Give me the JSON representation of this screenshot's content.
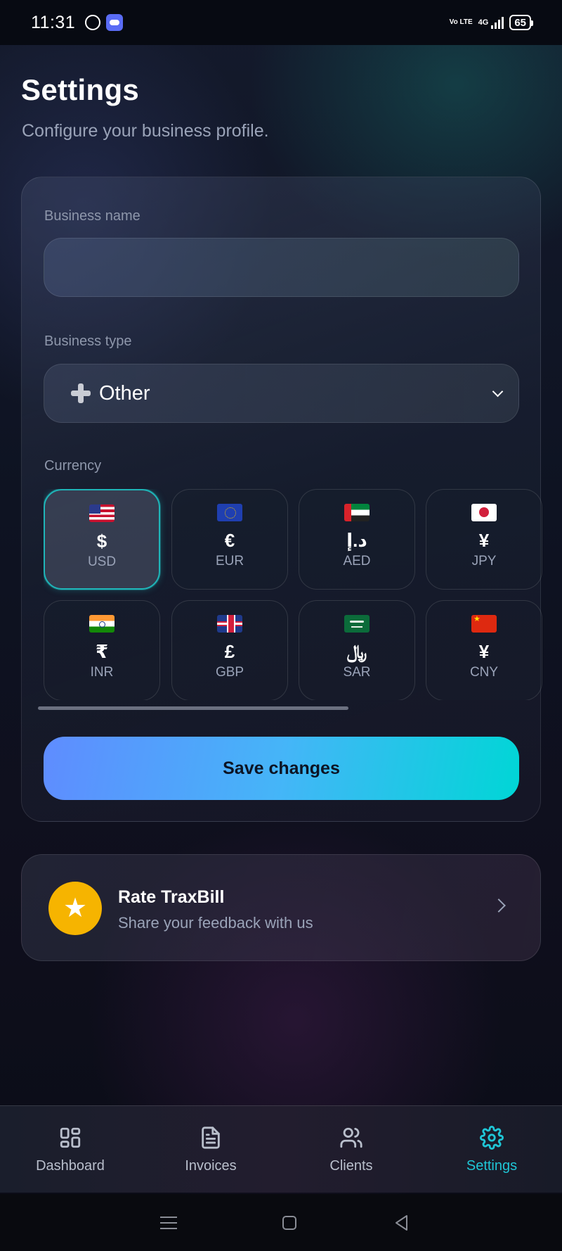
{
  "status_bar": {
    "time": "11:31",
    "network": "4G",
    "volte": "Vo LTE",
    "battery": "65"
  },
  "header": {
    "title": "Settings",
    "subtitle": "Configure your business profile."
  },
  "form": {
    "business_name_label": "Business name",
    "business_name_value": "",
    "business_type_label": "Business type",
    "business_type_icon": "plus-icon",
    "business_type_value": "Other",
    "currency_label": "Currency",
    "currencies": [
      {
        "code": "USD",
        "symbol": "$",
        "flag": "us-flag-icon",
        "selected": true
      },
      {
        "code": "EUR",
        "symbol": "€",
        "flag": "eu-flag-icon",
        "selected": false
      },
      {
        "code": "AED",
        "symbol": "د.إ",
        "flag": "ae-flag-icon",
        "selected": false
      },
      {
        "code": "JPY",
        "symbol": "¥",
        "flag": "jp-flag-icon",
        "selected": false
      },
      {
        "code": "INR",
        "symbol": "₹",
        "flag": "in-flag-icon",
        "selected": false
      },
      {
        "code": "GBP",
        "symbol": "£",
        "flag": "gb-flag-icon",
        "selected": false
      },
      {
        "code": "SAR",
        "symbol": "﷼",
        "flag": "sa-flag-icon",
        "selected": false
      },
      {
        "code": "CNY",
        "symbol": "¥",
        "flag": "cn-flag-icon",
        "selected": false
      }
    ],
    "save_label": "Save changes"
  },
  "rate": {
    "title": "Rate TraxBill",
    "subtitle": "Share your feedback with us",
    "icon": "star-icon"
  },
  "nav": {
    "items": [
      {
        "label": "Dashboard",
        "icon": "grid-icon",
        "active": false
      },
      {
        "label": "Invoices",
        "icon": "document-icon",
        "active": false
      },
      {
        "label": "Clients",
        "icon": "users-icon",
        "active": false
      },
      {
        "label": "Settings",
        "icon": "gear-icon",
        "active": true
      }
    ]
  },
  "colors": {
    "accent": "#1fc6d6",
    "selected_border": "#1fb5b8",
    "save_gradient_start": "#5f8cff",
    "save_gradient_end": "#00d6d6",
    "rate_icon_bg": "#f6b400"
  }
}
